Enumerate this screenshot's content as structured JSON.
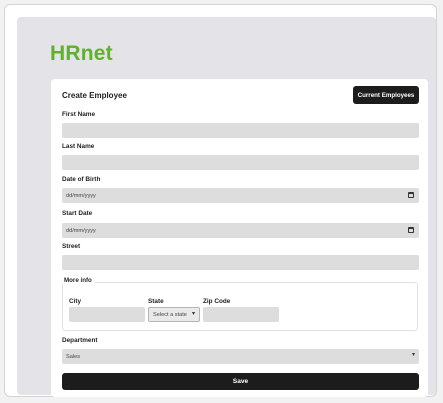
{
  "colors": {
    "brand": "#5fb02c",
    "button_bg": "#1c1c1c",
    "field_bg": "#dddddd",
    "page_bg": "#e4e4e8"
  },
  "header": {
    "logo": "HRnet"
  },
  "form": {
    "title": "Create Employee",
    "current_employees_label": "Current Employees",
    "first_name": {
      "label": "First Name",
      "value": ""
    },
    "last_name": {
      "label": "Last Name",
      "value": ""
    },
    "date_of_birth": {
      "label": "Date of Birth",
      "placeholder": "dd/mm/yyyy",
      "icon": "calendar-icon"
    },
    "start_date": {
      "label": "Start Date",
      "placeholder": "dd/mm/yyyy",
      "icon": "calendar-icon"
    },
    "street": {
      "label": "Street",
      "value": ""
    },
    "more_info": {
      "legend": "More info",
      "city": {
        "label": "City",
        "value": ""
      },
      "state": {
        "label": "State",
        "selected": "Select a state",
        "icon": "chevron-down-icon"
      },
      "zip": {
        "label": "Zip Code",
        "value": ""
      }
    },
    "department": {
      "label": "Department",
      "selected": "Sales",
      "icon": "chevron-down-icon"
    },
    "save_label": "Save"
  }
}
